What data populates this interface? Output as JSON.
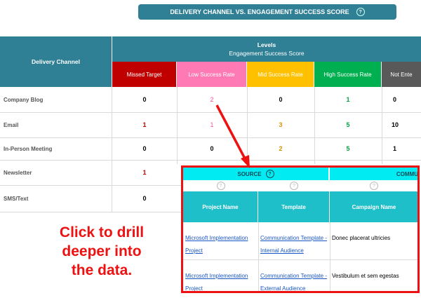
{
  "title": {
    "text": "DELIVERY CHANNEL VS. ENGAGEMENT SUCCESS SCORE",
    "help": "?"
  },
  "header": {
    "delivery_channel": "Delivery Channel",
    "levels": "Levels",
    "levels_sub": "Engagement Success Score"
  },
  "levels": [
    {
      "label": "Missed Target",
      "color": "#c00000"
    },
    {
      "label": "Low Success Rate",
      "color": "#ff7ab4"
    },
    {
      "label": "Mid Success Rate",
      "color": "#ffc000"
    },
    {
      "label": "High Success Rate",
      "color": "#00b050"
    },
    {
      "label": "Not Ente",
      "color": "#595959"
    }
  ],
  "rows": [
    {
      "label": "Company Blog",
      "values": [
        "0",
        "2",
        "0",
        "1",
        "0"
      ]
    },
    {
      "label": "Email",
      "values": [
        "1",
        "1",
        "3",
        "5",
        "10"
      ]
    },
    {
      "label": "In-Person Meeting",
      "values": [
        "0",
        "0",
        "2",
        "5",
        "1"
      ]
    },
    {
      "label": "Newsletter",
      "values": [
        "1"
      ]
    },
    {
      "label": "SMS/Text",
      "values": [
        "0"
      ]
    }
  ],
  "popup": {
    "source": "SOURCE",
    "source_help": "?",
    "second_group": "COMMU",
    "mini_help": "?",
    "columns": [
      "Project Name",
      "Template",
      "Campaign Name"
    ],
    "rows": [
      {
        "project": "Microsoft Implementation Project",
        "template": "Communication Template - Internal Audience",
        "campaign": "Donec placerat ultricies"
      },
      {
        "project": "Microsoft Implementation Project",
        "template": "Communication Template - External Audience",
        "campaign": "Vestibulum et sem egestas"
      }
    ]
  },
  "callout": {
    "line1": "Click to drill",
    "line2": "deeper into",
    "line3": "the data."
  },
  "colors": {
    "header_teal": "#2f7f95",
    "popup_teal": "#1fbfc9",
    "popup_cyan": "#00ecf2",
    "callout_red": "#ee1111"
  }
}
